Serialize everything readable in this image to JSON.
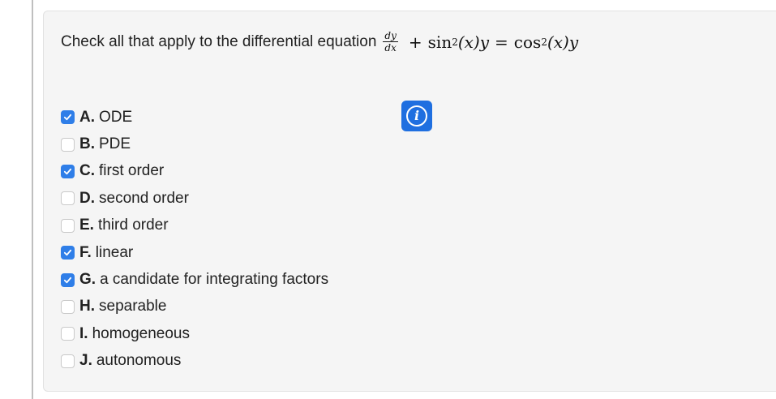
{
  "question": {
    "text": "Check all that apply to the differential equation",
    "equation": {
      "frac_num": "dy",
      "frac_den": "dx",
      "plus": "+",
      "sin": "sin",
      "exp1": "2",
      "arg1": "(x)y",
      "equals": "=",
      "cos": "cos",
      "exp2": "2",
      "arg2": "(x)y"
    }
  },
  "info_button": {
    "icon": "info-icon",
    "glyph": "i"
  },
  "colors": {
    "checkbox_checked": "#2f7ee8",
    "info_button": "#1f6fe0"
  },
  "options": [
    {
      "letter": "A.",
      "label": "ODE",
      "checked": true
    },
    {
      "letter": "B.",
      "label": "PDE",
      "checked": false
    },
    {
      "letter": "C.",
      "label": "first order",
      "checked": true
    },
    {
      "letter": "D.",
      "label": "second order",
      "checked": false
    },
    {
      "letter": "E.",
      "label": "third order",
      "checked": false
    },
    {
      "letter": "F.",
      "label": "linear",
      "checked": true
    },
    {
      "letter": "G.",
      "label": "a candidate for integrating factors",
      "checked": true
    },
    {
      "letter": "H.",
      "label": "separable",
      "checked": false
    },
    {
      "letter": "I.",
      "label": "homogeneous",
      "checked": false
    },
    {
      "letter": "J.",
      "label": "autonomous",
      "checked": false
    }
  ]
}
